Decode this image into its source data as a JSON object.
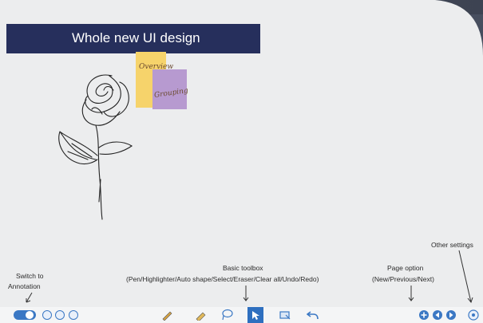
{
  "slide": {
    "title": "Whole new UI design",
    "note_yellow": "Overview",
    "note_purple": "Grouping"
  },
  "callouts": {
    "switch_line1": "Switch to",
    "switch_line2": "Annotation",
    "toolbox_title": "Basic toolbox",
    "toolbox_desc": "(Pen/Highlighter/Auto shape/Select/Eraser/Clear all/Undo/Redo)",
    "page_title": "Page option",
    "page_desc": "(New/Previous/Next)",
    "settings": "Other settings"
  },
  "toolbar": {
    "icons": [
      "toggle-switch",
      "save-icon",
      "text-icon",
      "share-icon",
      "pen-icon",
      "highlighter-icon",
      "lasso-icon",
      "select-icon",
      "eraser-icon",
      "undo-icon",
      "add-page-icon",
      "prev-page-icon",
      "next-page-icon",
      "settings-icon"
    ]
  },
  "colors": {
    "title_bar": "#262f5c",
    "accent_blue": "#3b78c4",
    "note_yellow": "#f6d36b",
    "note_purple": "#b79ad0"
  }
}
